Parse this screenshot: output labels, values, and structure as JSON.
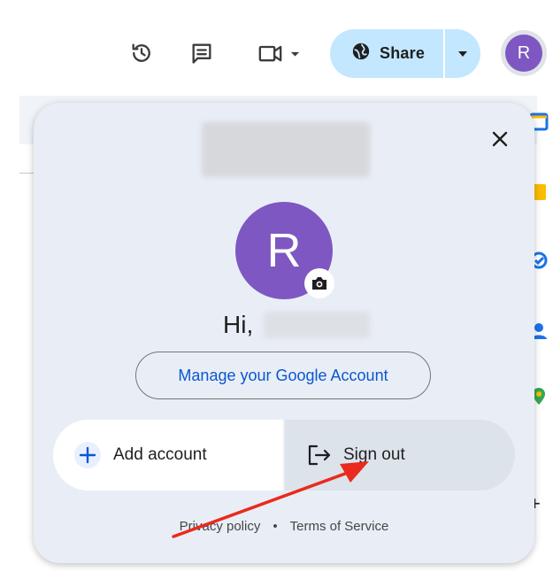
{
  "toolbar": {
    "icons": [
      "history-icon",
      "comment-icon",
      "meet-icon"
    ],
    "share_label": "Share",
    "avatar_letter": "R",
    "colors": {
      "share_bg": "#c2e7ff",
      "avatar": "#7e57c2"
    }
  },
  "panel": {
    "avatar_letter": "R",
    "greeting": "Hi,",
    "manage_label": "Manage your Google Account",
    "add_account_label": "Add account",
    "sign_out_label": "Sign out",
    "footer": {
      "privacy": "Privacy policy",
      "separator": "•",
      "terms": "Terms of Service"
    },
    "colors": {
      "background": "#e9eef6",
      "link": "#0b57d0"
    }
  },
  "annotation": {
    "color": "#ea2a1e",
    "target": "sign-out-button"
  }
}
